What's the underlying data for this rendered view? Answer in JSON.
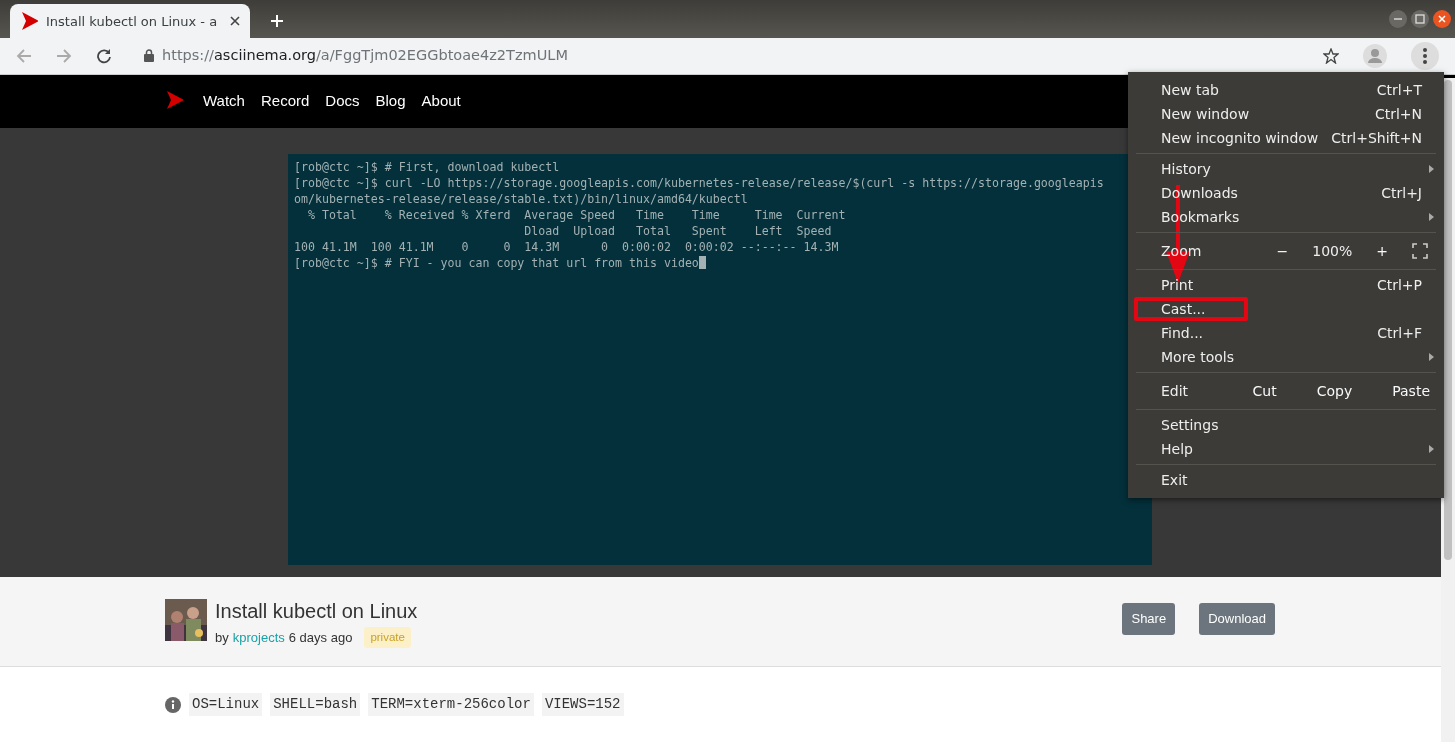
{
  "browser": {
    "tab": {
      "title": "Install kubectl on Linux - a",
      "selected": true
    },
    "url": {
      "scheme": "https://",
      "host": "asciinema.org",
      "path": "/a/FggTjm02EGGbtoae4z2TzmULM"
    }
  },
  "site_nav": [
    "Watch",
    "Record",
    "Docs",
    "Blog",
    "About"
  ],
  "terminal_lines": [
    "[rob@ctc ~]$ # First, download kubectl",
    "[rob@ctc ~]$ curl -LO https://storage.googleapis.com/kubernetes-release/release/$(curl -s https://storage.googleapis",
    "om/kubernetes-release/release/stable.txt)/bin/linux/amd64/kubectl",
    "  % Total    % Received % Xferd  Average Speed   Time    Time     Time  Current",
    "                                 Dload  Upload   Total   Spent    Left  Speed",
    "100 41.1M  100 41.1M    0     0  14.3M      0  0:00:02  0:00:02 --:--:-- 14.3M",
    "[rob@ctc ~]$ # FYI - you can copy that url from this video"
  ],
  "recording": {
    "title": "Install kubectl on Linux",
    "by": "by",
    "author": "kprojects",
    "age": "6 days ago",
    "badge": "private",
    "buttons": [
      "Share",
      "Download"
    ]
  },
  "meta": [
    "OS=Linux",
    "SHELL=bash",
    "TERM=xterm-256color",
    "VIEWS=152"
  ],
  "menu": [
    [
      {
        "kind": "item",
        "label": "New tab",
        "shortcut": "Ctrl+T"
      },
      {
        "kind": "item",
        "label": "New window",
        "shortcut": "Ctrl+N"
      },
      {
        "kind": "item",
        "label": "New incognito window",
        "shortcut": "Ctrl+Shift+N"
      }
    ],
    [
      {
        "kind": "item",
        "label": "History",
        "submenu": true
      },
      {
        "kind": "item",
        "label": "Downloads",
        "shortcut": "Ctrl+J"
      },
      {
        "kind": "item",
        "label": "Bookmarks",
        "submenu": true
      }
    ],
    [
      {
        "kind": "zoom",
        "label": "Zoom",
        "minus": "−",
        "value": "100%",
        "plus": "+"
      }
    ],
    [
      {
        "kind": "item",
        "label": "Print",
        "shortcut": "Ctrl+P"
      },
      {
        "kind": "item",
        "label": "Cast...",
        "highlighted": true
      },
      {
        "kind": "item",
        "label": "Find...",
        "shortcut": "Ctrl+F"
      },
      {
        "kind": "item",
        "label": "More tools",
        "submenu": true
      }
    ],
    [
      {
        "kind": "edit",
        "label": "Edit",
        "actions": [
          "Cut",
          "Copy",
          "Paste"
        ]
      }
    ],
    [
      {
        "kind": "item",
        "label": "Settings"
      },
      {
        "kind": "item",
        "label": "Help",
        "submenu": true
      }
    ],
    [
      {
        "kind": "item",
        "label": "Exit"
      }
    ]
  ]
}
